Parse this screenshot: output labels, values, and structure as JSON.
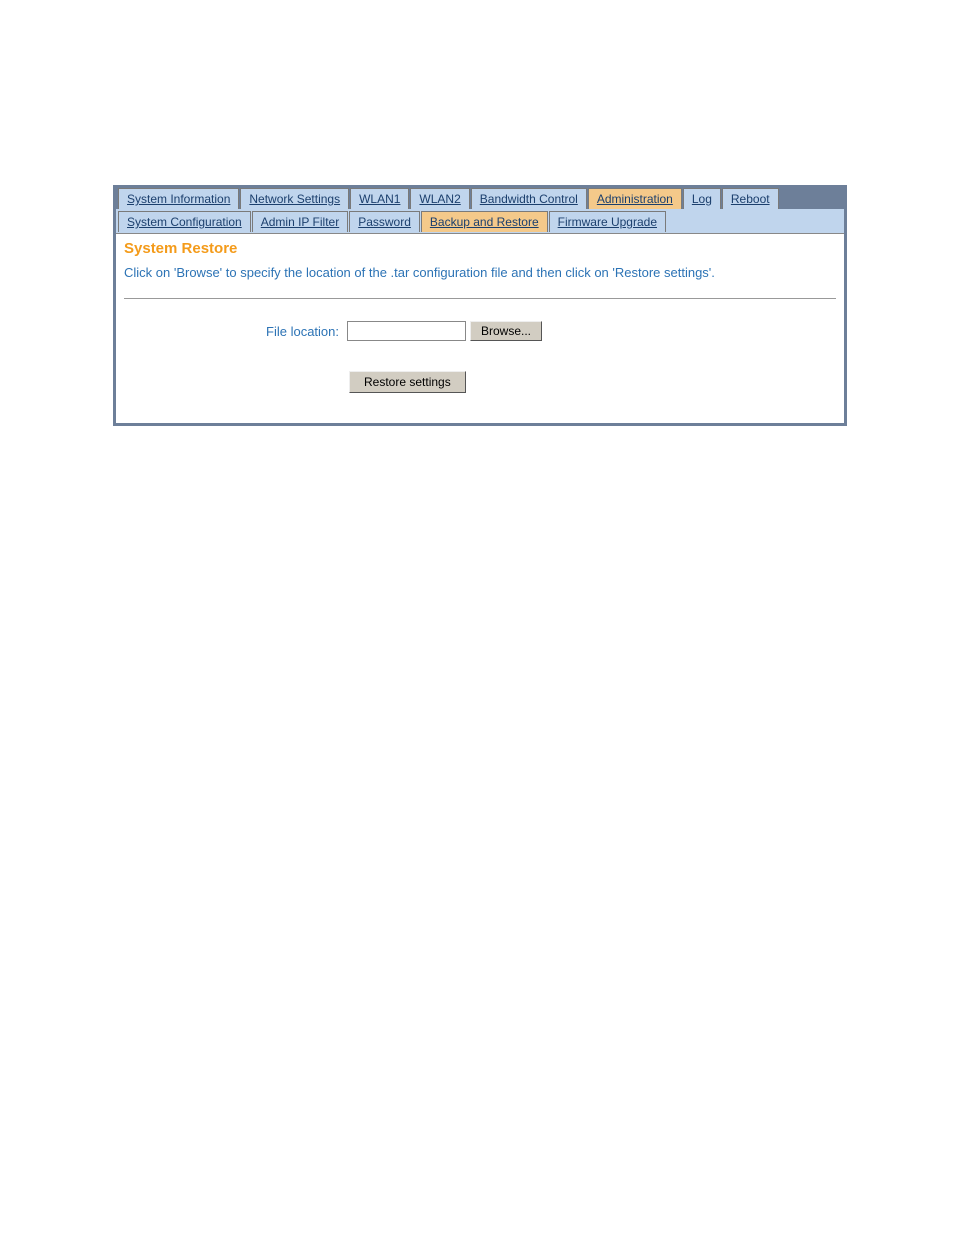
{
  "tabs_primary": [
    {
      "label": "System Information",
      "name": "tab-system-information",
      "active": false
    },
    {
      "label": "Network Settings",
      "name": "tab-network-settings",
      "active": false
    },
    {
      "label": "WLAN1",
      "name": "tab-wlan1",
      "active": false
    },
    {
      "label": "WLAN2",
      "name": "tab-wlan2",
      "active": false
    },
    {
      "label": "Bandwidth Control",
      "name": "tab-bandwidth-control",
      "active": false
    },
    {
      "label": "Administration",
      "name": "tab-administration",
      "active": true
    },
    {
      "label": "Log",
      "name": "tab-log",
      "active": false
    },
    {
      "label": "Reboot",
      "name": "tab-reboot",
      "active": false
    }
  ],
  "tabs_secondary": [
    {
      "label": "System Configuration",
      "name": "subtab-system-configuration",
      "active": false
    },
    {
      "label": "Admin IP Filter",
      "name": "subtab-admin-ip-filter",
      "active": false
    },
    {
      "label": "Password",
      "name": "subtab-password",
      "active": false
    },
    {
      "label": "Backup and Restore",
      "name": "subtab-backup-and-restore",
      "active": true
    },
    {
      "label": "Firmware Upgrade",
      "name": "subtab-firmware-upgrade",
      "active": false
    }
  ],
  "content": {
    "title": "System Restore",
    "description": "Click on 'Browse' to specify the location of the .tar configuration file and then click on 'Restore settings'.",
    "file_location_label": "File location:",
    "file_location_value": "",
    "browse_label": "Browse...",
    "restore_label": "Restore settings"
  }
}
